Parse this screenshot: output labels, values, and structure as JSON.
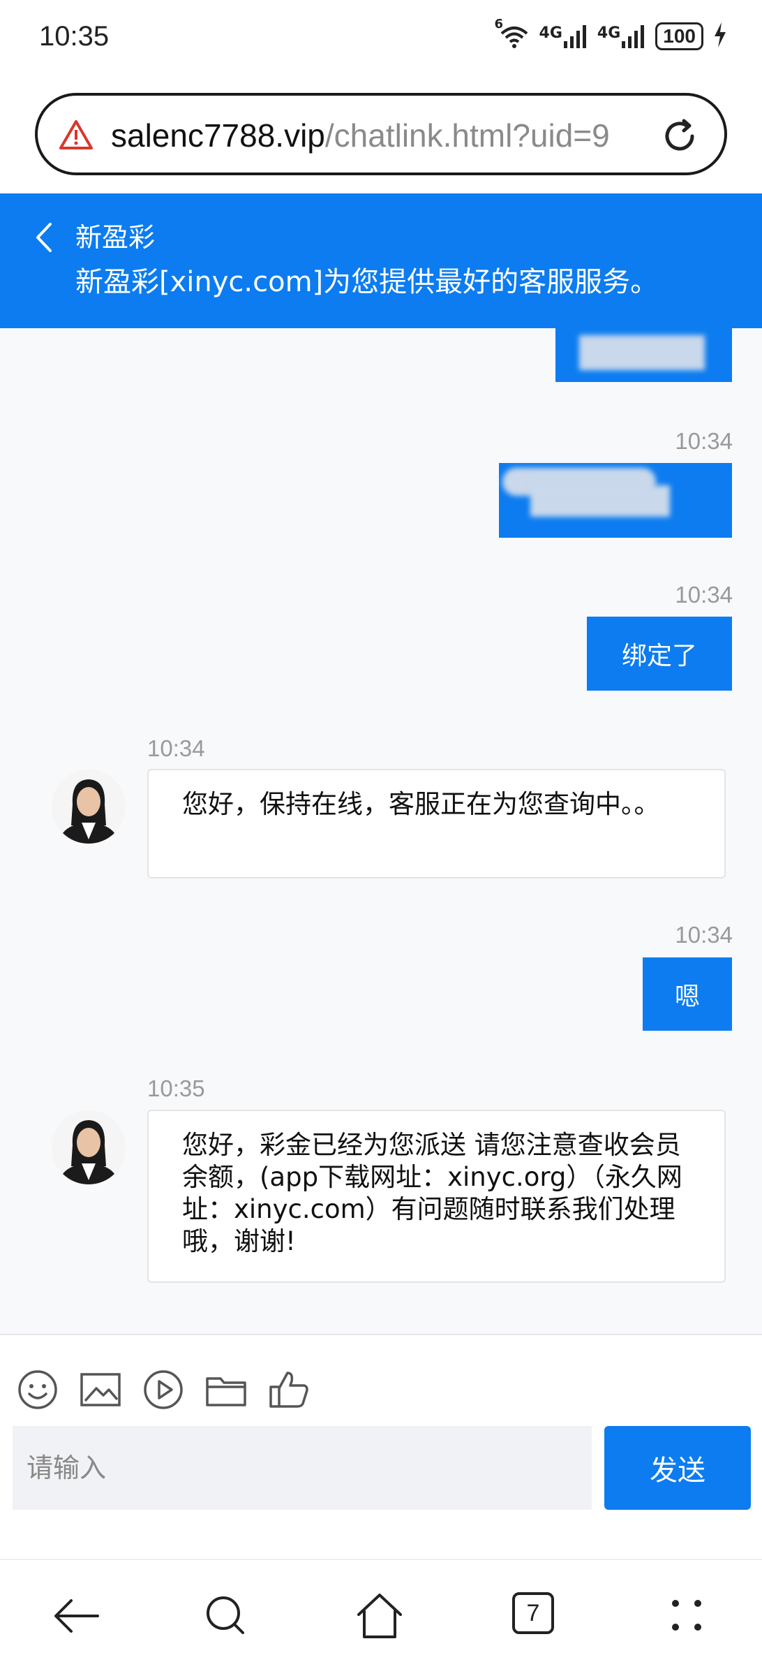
{
  "status_bar": {
    "time": "10:35",
    "wifi_label": "6",
    "signal1_label": "4G",
    "signal2_label": "4G",
    "battery": "100"
  },
  "url_bar": {
    "domain": "salenc7788.vip",
    "path": "/chatlink.html?uid=9"
  },
  "header": {
    "title": "新盈彩",
    "subtitle": "新盈彩[xinyc.com]为您提供最好的客服服务。",
    "background_color": "#0c7cf0"
  },
  "messages": [
    {
      "direction": "out",
      "text": "",
      "obscured": true
    },
    {
      "direction": "out",
      "time": "10:34",
      "text": "",
      "obscured": true
    },
    {
      "direction": "out",
      "time": "10:34",
      "text": "绑定了"
    },
    {
      "direction": "in",
      "time": "10:34",
      "text": "您好，保持在线，客服正在为您查询中。。"
    },
    {
      "direction": "out",
      "time": "10:34",
      "text": "嗯"
    },
    {
      "direction": "in",
      "time": "10:35",
      "text": "您好，彩金已经为您派送 请您注意查收会员余额，(app下载网址：xinyc.org）（永久网址：xinyc.com）有问题随时联系我们处理哦，谢谢!"
    }
  ],
  "toolbar": {
    "icons": [
      "emoji-icon",
      "image-icon",
      "video-icon",
      "folder-icon",
      "thumbs-up-icon"
    ]
  },
  "input": {
    "placeholder": "请输入",
    "send_label": "发送"
  },
  "browser_nav": {
    "tab_count": "7"
  }
}
